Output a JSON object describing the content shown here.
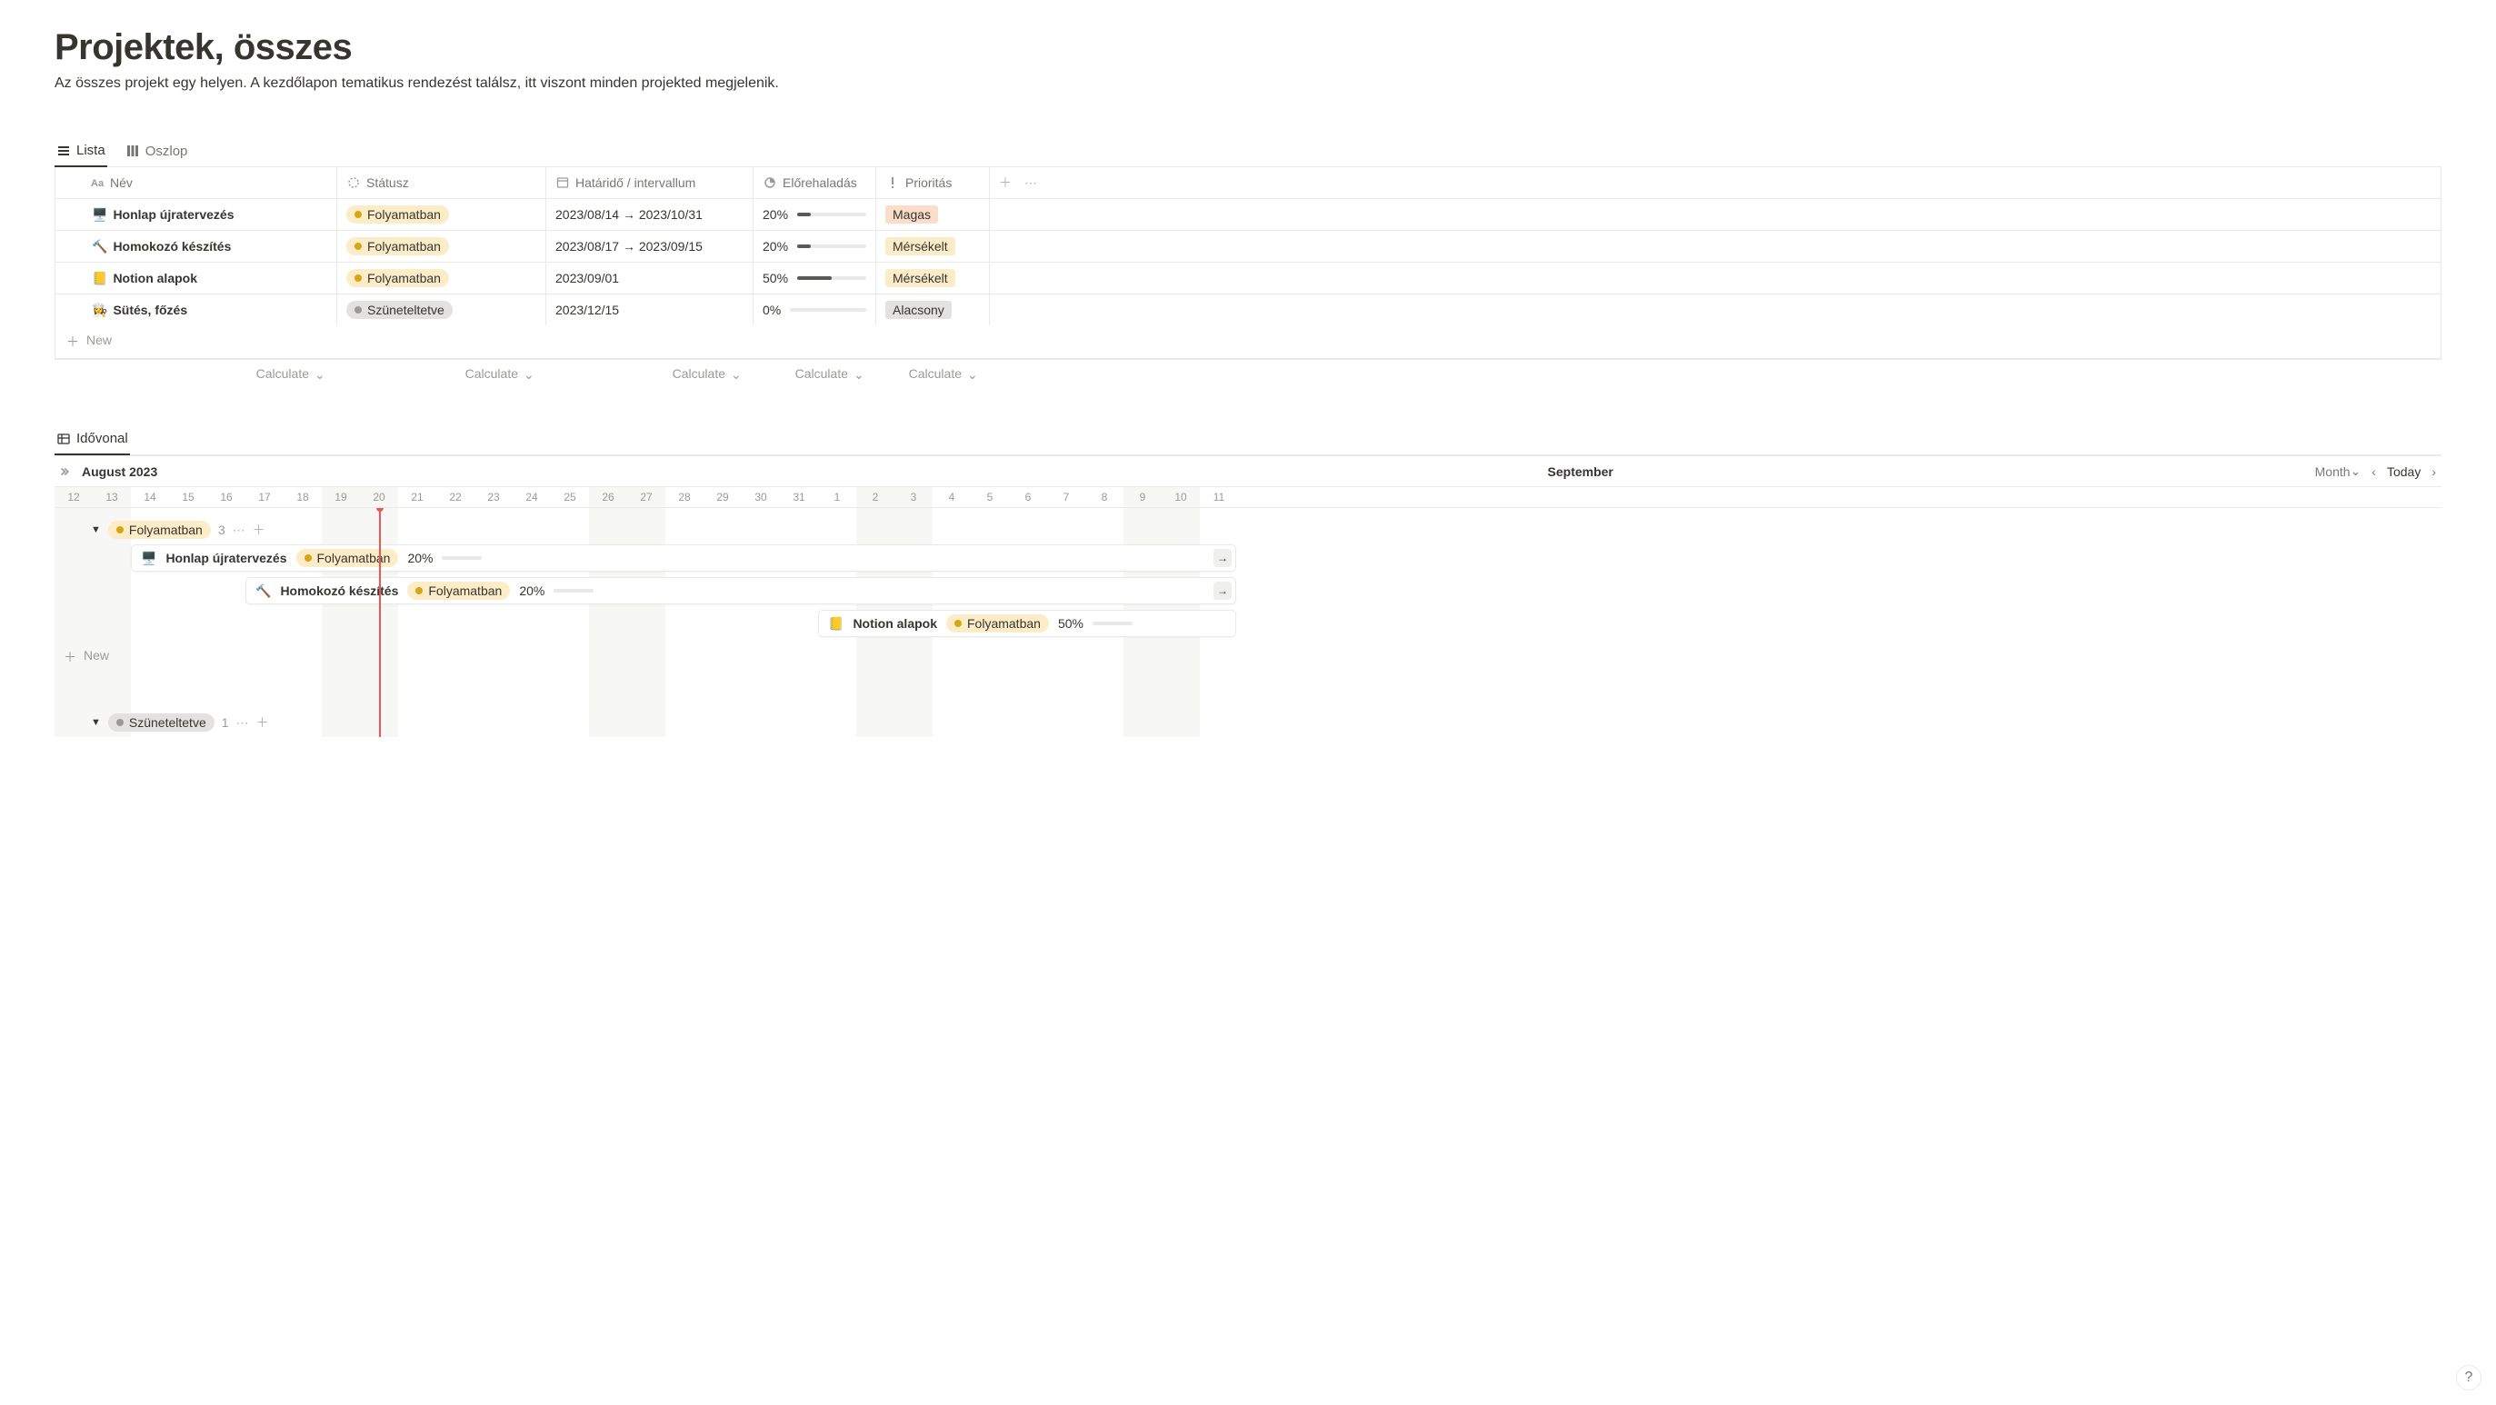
{
  "page": {
    "title": "Projektek, összes",
    "subtitle": "Az összes projekt egy helyen. A kezdőlapon tematikus rendezést találsz, itt viszont minden projekted megjelenik."
  },
  "tabs": {
    "list": "Lista",
    "board": "Oszlop",
    "timeline": "Idővonal"
  },
  "columns": {
    "name": "Név",
    "status": "Státusz",
    "date": "Határidő / intervallum",
    "progress": "Előrehaladás",
    "priority": "Prioritás"
  },
  "rows": [
    {
      "icon": "🖥️",
      "name": "Honlap újratervezés",
      "status_label": "Folyamatban",
      "status_style": "yellow",
      "date": "2023/08/14 → 2023/10/31",
      "progress_label": "20%",
      "progress_pct": 20,
      "priority_label": "Magas",
      "priority_style": "high"
    },
    {
      "icon": "🔨",
      "name": "Homokozó készítés",
      "status_label": "Folyamatban",
      "status_style": "yellow",
      "date": "2023/08/17 → 2023/09/15",
      "progress_label": "20%",
      "progress_pct": 20,
      "priority_label": "Mérsékelt",
      "priority_style": "med"
    },
    {
      "icon": "📒",
      "name": "Notion alapok",
      "status_label": "Folyamatban",
      "status_style": "yellow",
      "date": "2023/09/01",
      "progress_label": "50%",
      "progress_pct": 50,
      "priority_label": "Mérsékelt",
      "priority_style": "med"
    },
    {
      "icon": "👩‍🍳",
      "name": "Sütés, főzés",
      "status_label": "Szüneteltetve",
      "status_style": "gray",
      "date": "2023/12/15",
      "progress_label": "0%",
      "progress_pct": 0,
      "priority_label": "Alacsony",
      "priority_style": "low"
    }
  ],
  "buttons": {
    "new": "New",
    "calculate": "Calculate",
    "today": "Today",
    "month": "Month",
    "help": "?"
  },
  "timeline": {
    "header_month": "August 2023",
    "header_middle": "September",
    "days": [
      "12",
      "13",
      "14",
      "15",
      "16",
      "17",
      "18",
      "19",
      "20",
      "21",
      "22",
      "23",
      "24",
      "25",
      "26",
      "27",
      "28",
      "29",
      "30",
      "31",
      "1",
      "2",
      "3",
      "4",
      "5",
      "6",
      "7",
      "8",
      "9",
      "10",
      "11"
    ],
    "weekend_idx": [
      0,
      1,
      7,
      8,
      14,
      15,
      21,
      22,
      28,
      29
    ],
    "today_idx": 8,
    "groups": [
      {
        "label": "Folyamatban",
        "style": "yellow",
        "count": "3"
      },
      {
        "label": "Szüneteltetve",
        "style": "gray",
        "count": "1"
      }
    ],
    "bars": [
      {
        "icon": "🖥️",
        "name": "Honlap újratervezés",
        "status_label": "Folyamatban",
        "progress_label": "20%",
        "progress_pct": 20,
        "start_idx": 2,
        "span": 100,
        "arrow": true
      },
      {
        "icon": "🔨",
        "name": "Homokozó készítés",
        "status_label": "Folyamatban",
        "progress_label": "20%",
        "progress_pct": 20,
        "start_idx": 5,
        "span": 100,
        "arrow": true
      },
      {
        "icon": "📒",
        "name": "Notion alapok",
        "status_label": "Folyamatban",
        "progress_label": "50%",
        "progress_pct": 50,
        "start_idx": 20,
        "span": 11,
        "arrow": false
      }
    ]
  }
}
